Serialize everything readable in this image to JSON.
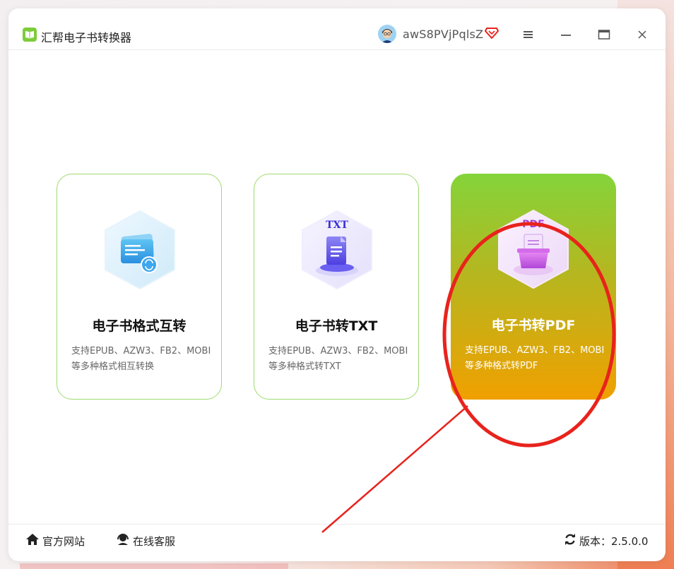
{
  "app": {
    "title": "汇帮电子书转换器",
    "username": "awS8PVjPqlsZ"
  },
  "cards": [
    {
      "title": "电子书格式互转",
      "desc_line1": "支持EPUB、AZW3、FB2、MOBI",
      "desc_line2": "等多种格式相互转换",
      "icon": "ebook-convert-icon",
      "active": false
    },
    {
      "title": "电子书转TXT",
      "desc_line1": "支持EPUB、AZW3、FB2、MOBI",
      "desc_line2": "等多种格式转TXT",
      "icon": "txt-icon",
      "icon_label": "TXT",
      "active": false
    },
    {
      "title": "电子书转PDF",
      "desc_line1": "支持EPUB、AZW3、FB2、MOBI",
      "desc_line2": "等多种格式转PDF",
      "icon": "pdf-icon",
      "icon_label": "PDF",
      "active": true
    }
  ],
  "footer": {
    "website_label": "官方网站",
    "support_label": "在线客服",
    "version_label": "版本：2.5.0.0"
  },
  "colors": {
    "accent": "#7dcc3a",
    "card_border": "#9fdb6e",
    "active_top": "#84d43a",
    "active_bottom": "#f0a000",
    "annotation": "#e8231c"
  }
}
